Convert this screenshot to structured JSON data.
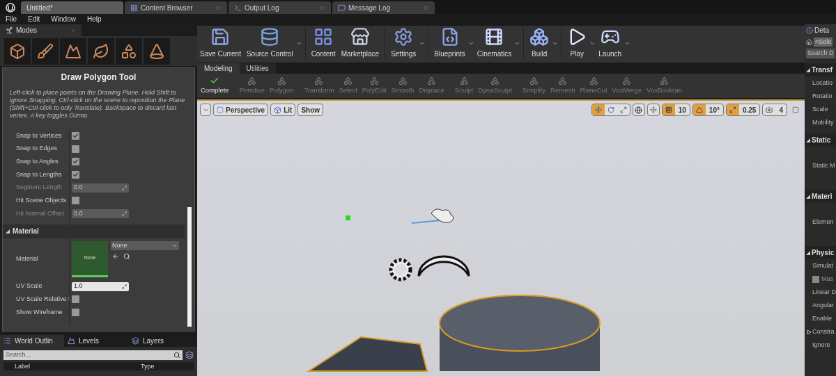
{
  "doc_tabs": [
    {
      "label": "Untitled*",
      "selected": true
    },
    {
      "label": "Content Browser",
      "selected": false
    },
    {
      "label": "Output Log",
      "selected": false
    },
    {
      "label": "Message Log",
      "selected": false
    }
  ],
  "menu": [
    "File",
    "Edit",
    "Window",
    "Help"
  ],
  "modes_panel": {
    "title": "Modes",
    "tool_title": "Draw Polygon Tool",
    "description": "Left-click to place points on the Drawing Plane. Hold Shift to ignore Snapping. Ctrl-click on the scene to reposition the Plane (Shift+Ctrl-click to only Translate). Backspace to discard last vertex. A key toggles Gizmo.",
    "properties": [
      {
        "label": "Snap to Vertices",
        "kind": "checkbox",
        "checked": true,
        "disabled": false
      },
      {
        "label": "Snap to Edges",
        "kind": "checkbox",
        "checked": false,
        "disabled": false
      },
      {
        "label": "Snap to Angles",
        "kind": "checkbox",
        "checked": true,
        "disabled": false
      },
      {
        "label": "Snap to Lengths",
        "kind": "checkbox",
        "checked": true,
        "disabled": false
      },
      {
        "label": "Segment Length",
        "kind": "number",
        "value": "0.0",
        "disabled": true
      },
      {
        "label": "Hit Scene Objects",
        "kind": "checkbox",
        "checked": false,
        "disabled": false
      },
      {
        "label": "Hit Normal Offset",
        "kind": "number",
        "value": "0.0",
        "disabled": true
      }
    ],
    "material_section": {
      "title": "Material",
      "expanded": true,
      "material_label": "Material",
      "thumbnail_text": "None",
      "dropdown_value": "None",
      "properties": [
        {
          "label": "UV Scale",
          "kind": "number",
          "value": "1.0",
          "disabled": false
        },
        {
          "label": "UV Scale Relative t",
          "kind": "checkbox",
          "checked": false,
          "disabled": false
        },
        {
          "label": "Show Wireframe",
          "kind": "checkbox",
          "checked": false,
          "disabled": false
        }
      ]
    }
  },
  "bottom_tabs": [
    {
      "label": "World Outlin",
      "selected": true
    },
    {
      "label": "Levels",
      "selected": false
    },
    {
      "label": "Layers",
      "selected": false
    }
  ],
  "outliner": {
    "search_placeholder": "Search...",
    "columns": [
      "Label",
      "Type"
    ]
  },
  "toolbar": [
    {
      "label": "Save Current",
      "dropdown": false
    },
    {
      "label": "Source Control",
      "dropdown": true
    },
    {
      "label": "Content",
      "dropdown": false
    },
    {
      "label": "Marketplace",
      "dropdown": false
    },
    {
      "label": "Settings",
      "dropdown": true
    },
    {
      "label": "Blueprints",
      "dropdown": true
    },
    {
      "label": "Cinematics",
      "dropdown": true
    },
    {
      "label": "Build",
      "dropdown": true
    },
    {
      "label": "Play",
      "dropdown": true
    },
    {
      "label": "Launch",
      "dropdown": true
    }
  ],
  "mode_tabs": [
    {
      "label": "Modeling",
      "selected": true
    },
    {
      "label": "Utilities",
      "selected": false
    }
  ],
  "modeling_tools": [
    {
      "label": "Complete",
      "disabled": false
    },
    {
      "label": "Primitive",
      "disabled": true
    },
    {
      "label": "Polygon",
      "disabled": true
    },
    {
      "label": "Transform",
      "disabled": true
    },
    {
      "label": "Select",
      "disabled": true
    },
    {
      "label": "PolyEdit",
      "disabled": true
    },
    {
      "label": "Smooth",
      "disabled": true
    },
    {
      "label": "Displace",
      "disabled": true
    },
    {
      "label": "Sculpt",
      "disabled": true
    },
    {
      "label": "DynaSculpt",
      "disabled": true
    },
    {
      "label": "Simplify",
      "disabled": true
    },
    {
      "label": "Remesh",
      "disabled": true
    },
    {
      "label": "PlaneCut",
      "disabled": true
    },
    {
      "label": "VoxMerge",
      "disabled": true
    },
    {
      "label": "VoxBoolean",
      "disabled": true
    }
  ],
  "viewport": {
    "buttons": [
      "Perspective",
      "Lit",
      "Show"
    ],
    "transform_modes": [
      {
        "selected": true
      },
      {
        "selected": false
      },
      {
        "selected": false
      }
    ],
    "snaps": [
      {
        "on": true,
        "value": "10"
      },
      {
        "on": true,
        "value": "10°"
      },
      {
        "on": true,
        "value": "0.25"
      },
      {
        "on": false,
        "value": "4"
      }
    ]
  },
  "details_panel": {
    "title": "Deta",
    "actor_field": "<Sele",
    "search_placeholder": "Search D",
    "rows": [
      {
        "kind": "section",
        "label": "Transf",
        "expanded": true
      },
      {
        "kind": "row",
        "label": "Locatio"
      },
      {
        "kind": "row",
        "label": "Rotatio"
      },
      {
        "kind": "row",
        "label": "Scale"
      },
      {
        "kind": "row",
        "label": "Mobility"
      },
      {
        "kind": "section",
        "label": "Static",
        "expanded": true
      },
      {
        "kind": "tall",
        "label": "Static M"
      },
      {
        "kind": "section",
        "label": "Materi",
        "expanded": true
      },
      {
        "kind": "tall",
        "label": "Elemen"
      },
      {
        "kind": "section",
        "label": "Physic",
        "expanded": true
      },
      {
        "kind": "row",
        "label": "Simulat"
      },
      {
        "kind": "check",
        "label": "Mas",
        "checked": false
      },
      {
        "kind": "row",
        "label": "Linear D"
      },
      {
        "kind": "row",
        "label": "Angular"
      },
      {
        "kind": "row",
        "label": "Enable"
      },
      {
        "kind": "group",
        "label": "Constra",
        "expanded": false
      },
      {
        "kind": "row",
        "label": "Ignore"
      }
    ]
  }
}
